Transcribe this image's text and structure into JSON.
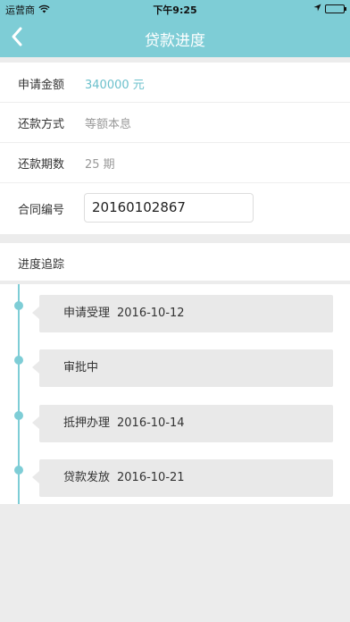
{
  "status_bar": {
    "carrier": "运营商",
    "time": "下午9:25"
  },
  "nav": {
    "title": "贷款进度",
    "back_icon": "chevron-left-icon"
  },
  "loan_info": {
    "amount_label": "申请金额",
    "amount_value": "340000 元",
    "repay_method_label": "还款方式",
    "repay_method_value": "等额本息",
    "term_label": "还款期数",
    "term_value": "25 期",
    "contract_label": "合同编号",
    "contract_value": "20160102867"
  },
  "progress": {
    "title": "进度追踪",
    "steps": [
      {
        "label": "申请受理",
        "date": "2016-10-12"
      },
      {
        "label": "审批中",
        "date": ""
      },
      {
        "label": "抵押办理",
        "date": "2016-10-14"
      },
      {
        "label": "贷款发放",
        "date": "2016-10-21"
      }
    ]
  },
  "colors": {
    "accent": "#7ecdd6",
    "amount": "#6cc0cc",
    "background": "#ececec"
  }
}
